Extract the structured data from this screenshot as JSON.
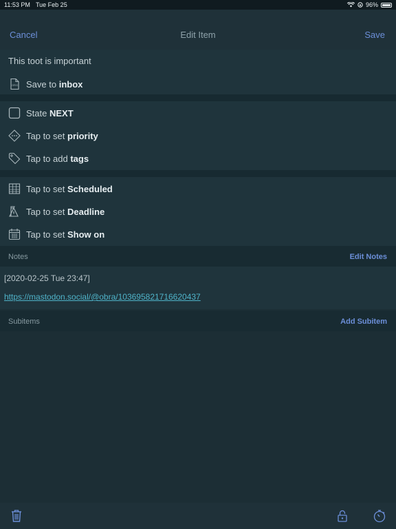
{
  "status_bar": {
    "time": "11:53 PM",
    "date": "Tue Feb 25",
    "battery": "96%",
    "battery_level": 0.96
  },
  "nav": {
    "cancel": "Cancel",
    "title": "Edit Item",
    "save": "Save"
  },
  "item": {
    "title": "This toot is important",
    "save_to_prefix": "Save to",
    "save_to_target": "inbox"
  },
  "state": {
    "prefix": "State",
    "value": "NEXT"
  },
  "priority": {
    "prefix": "Tap to set",
    "value": "priority"
  },
  "tags": {
    "prefix": "Tap to add",
    "value": "tags"
  },
  "scheduled": {
    "prefix": "Tap to set",
    "value": "Scheduled"
  },
  "deadline": {
    "prefix": "Tap to set",
    "value": "Deadline"
  },
  "show_on": {
    "prefix": "Tap to set",
    "value": "Show on"
  },
  "notes": {
    "header": "Notes",
    "action": "Edit Notes",
    "timestamp": "[2020-02-25 Tue 23:47]",
    "link": "https://mastodon.social/@obra/103695821716620437"
  },
  "subitems": {
    "header": "Subitems",
    "action": "Add Subitem"
  },
  "colors": {
    "accent": "#6c8fd9",
    "link": "#4fb3c9",
    "background": "#1c2e35"
  },
  "icons": {
    "trash": "trash-icon",
    "lock": "lock-icon",
    "timer": "timer-icon"
  }
}
